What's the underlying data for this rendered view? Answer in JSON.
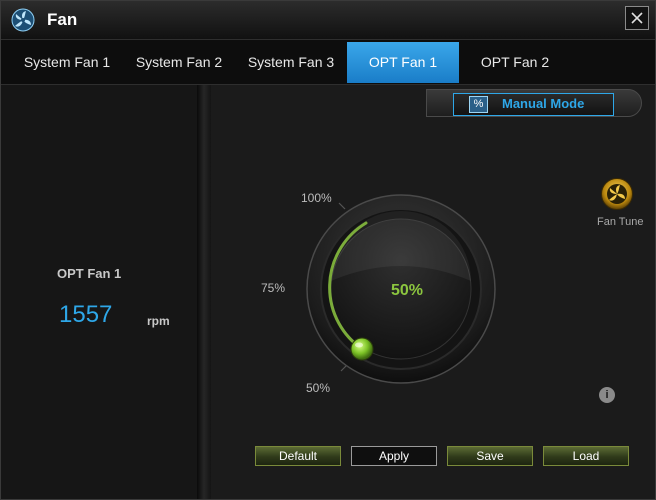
{
  "window": {
    "title": "Fan"
  },
  "tabs": [
    {
      "label": "System Fan 1",
      "active": false
    },
    {
      "label": "System Fan 2",
      "active": false
    },
    {
      "label": "System Fan 3",
      "active": false
    },
    {
      "label": "OPT Fan 1",
      "active": true
    },
    {
      "label": "OPT Fan 2",
      "active": false
    }
  ],
  "left_panel": {
    "fan_name": "OPT Fan 1",
    "rpm": "1557",
    "rpm_unit": "rpm"
  },
  "mode": {
    "label": "Manual Mode",
    "icon": "percent-icon",
    "icon_glyph": "%"
  },
  "fan_tune": {
    "label": "Fan Tune",
    "icon": "fan-tune-icon"
  },
  "dial": {
    "value_text": "50%",
    "value_percent": 50,
    "labels": {
      "top": "100%",
      "middle": "75%",
      "bottom": "50%"
    }
  },
  "info": {
    "glyph": "i"
  },
  "buttons": {
    "default": "Default",
    "apply": "Apply",
    "save": "Save",
    "load": "Load"
  },
  "colors": {
    "accent_blue": "#2ea7e8",
    "active_tab": "#1f8ad6",
    "dial_green": "#8cc63f"
  }
}
